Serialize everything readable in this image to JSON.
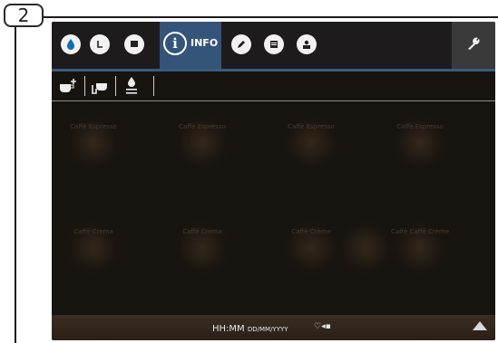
{
  "step": {
    "label": "2"
  },
  "topbar": {
    "icons": [
      {
        "name": "water-drop-icon"
      },
      {
        "name": "clock-icon"
      },
      {
        "name": "flag-icon"
      }
    ],
    "info_tab": {
      "label": "INFO"
    },
    "icons_right": [
      {
        "name": "pencil-icon"
      },
      {
        "name": "list-icon"
      },
      {
        "name": "user-icon"
      }
    ],
    "wrench": {
      "name": "wrench-icon"
    }
  },
  "toolbar": {
    "icons": [
      {
        "name": "cup-add-icon"
      },
      {
        "name": "cup-touch-icon"
      },
      {
        "name": "drop-list-icon"
      }
    ]
  },
  "products": [
    {
      "label": "Caffè Espresso"
    },
    {
      "label": "Caffè Espresso"
    },
    {
      "label": "Caffè Espresso"
    },
    {
      "label": "Caffè Espresso"
    },
    {
      "label": "Caffè Crema"
    },
    {
      "label": "Caffè Crema"
    },
    {
      "label": "Caffè Crème"
    },
    {
      "label": ""
    },
    {
      "label": "Caffè Caffè Crème"
    }
  ],
  "statusbar": {
    "time": "HH:MM",
    "date": "DD/MM/YYYY",
    "icons": "♡◂▪"
  },
  "colors": {
    "accent": "#34547a",
    "screen_bg": "#17130f"
  }
}
